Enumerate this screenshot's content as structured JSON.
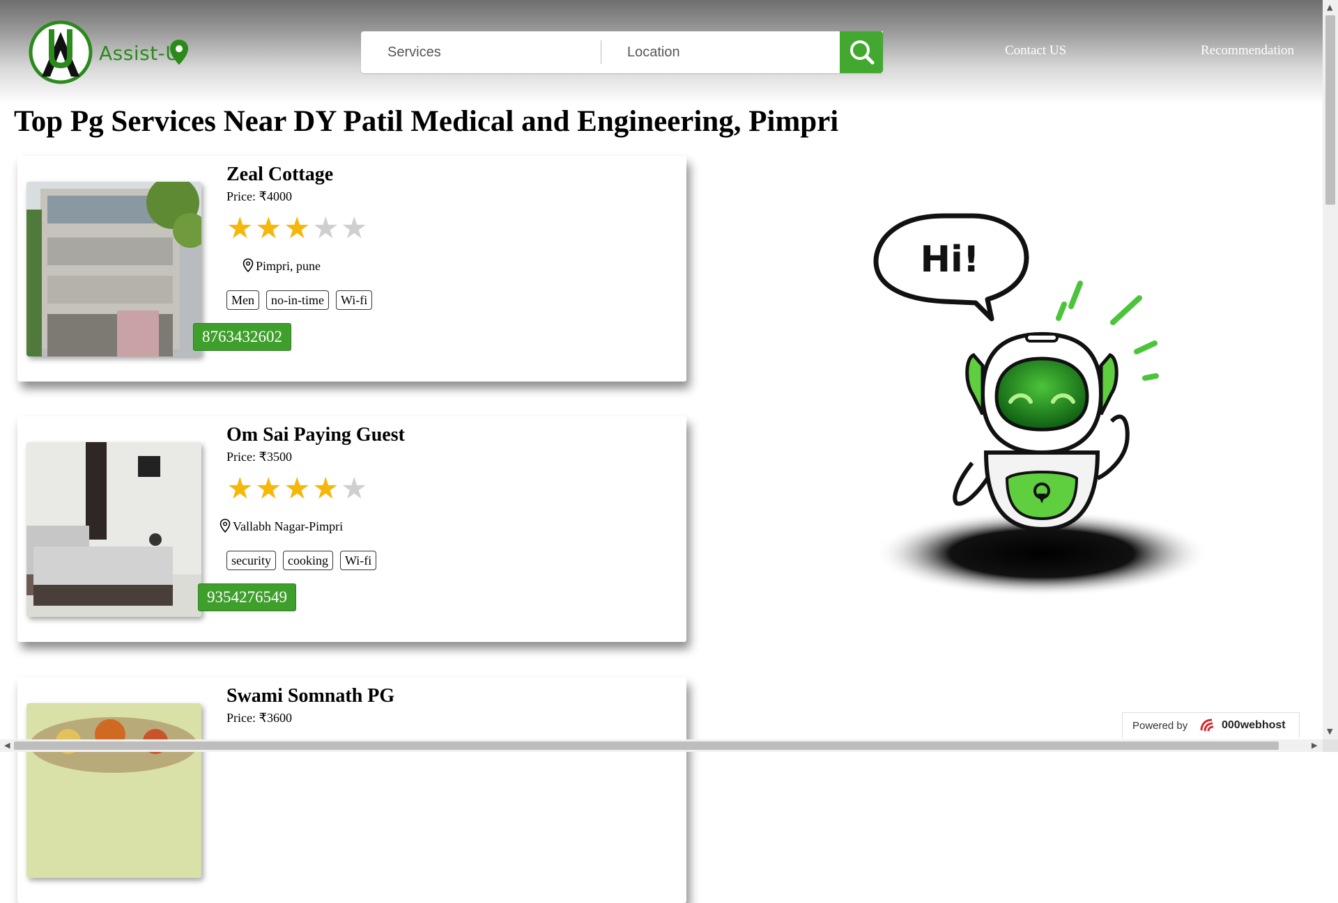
{
  "header": {
    "logo_text": "Assist-U",
    "services_placeholder": "Services",
    "location_placeholder": "Location",
    "nav": {
      "contact": "Contact US",
      "recommendation": "Recommendation"
    }
  },
  "page_title": "Top Pg Services Near DY Patil Medical and Engineering, Pimpri",
  "listings": [
    {
      "name": "Zeal Cottage",
      "price": "Price: ₹4000",
      "rating": 3,
      "rating_max": 5,
      "location": "Pimpri, pune",
      "tags": [
        "Men",
        "no-in-time",
        "Wi-fi"
      ],
      "phone": "8763432602"
    },
    {
      "name": "Om Sai Paying Guest",
      "price": "Price: ₹3500",
      "rating": 4,
      "rating_max": 5,
      "location": "Vallabh Nagar-Pimpri",
      "tags": [
        "security",
        "cooking",
        "Wi-fi"
      ],
      "phone": "9354276549"
    },
    {
      "name": "Swami Somnath PG",
      "price": "Price: ₹3600"
    }
  ],
  "robot_speech": "Hi!",
  "powered_by": {
    "label": "Powered by",
    "brand": "000webhost"
  },
  "colors": {
    "accent_green": "#43a830",
    "star_on": "#f5b70a",
    "star_off": "#cfcfcf"
  },
  "icons": [
    "search-icon",
    "location-pin-icon",
    "map-pin-outline-icon",
    "robot-illustration"
  ]
}
